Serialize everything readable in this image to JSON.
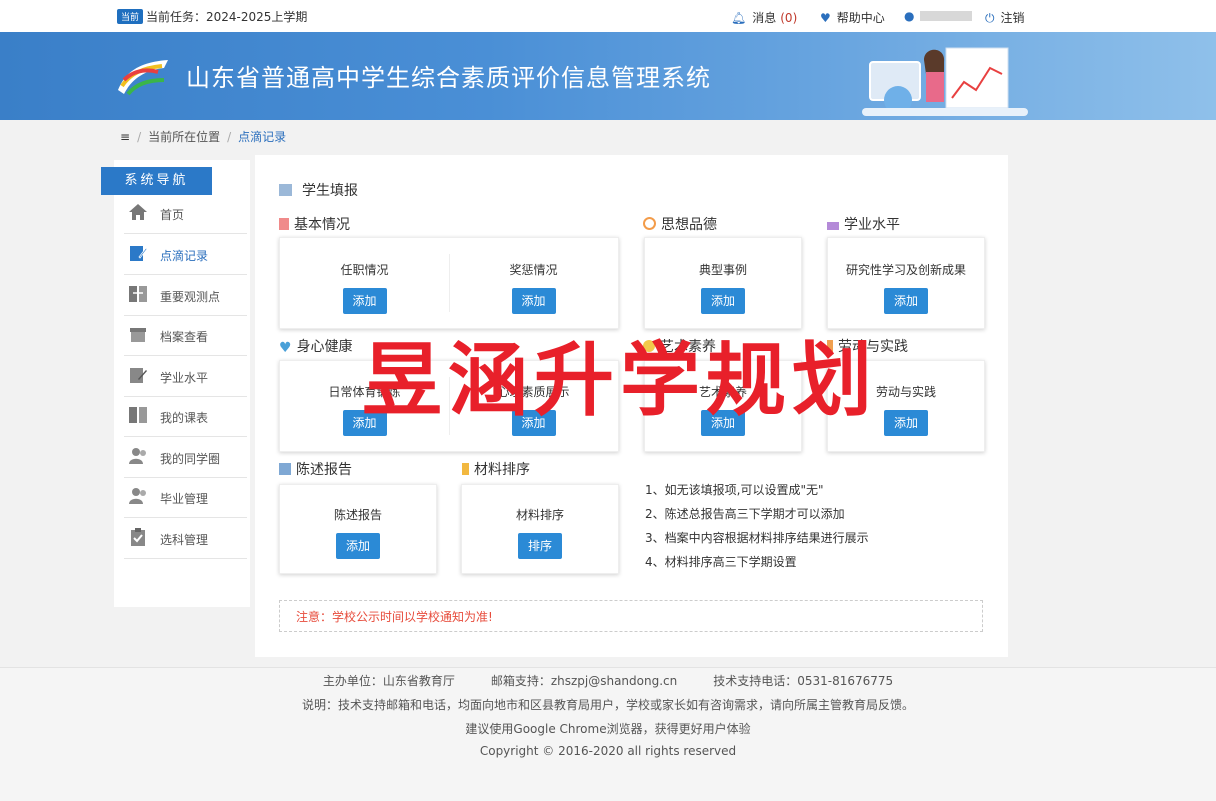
{
  "topbar": {
    "tag": "当前",
    "term_label": "当前任务：2024-2025上学期",
    "messages_label": "消息",
    "messages_count": "(0)",
    "help_label": "帮助中心",
    "logout_label": "注销"
  },
  "banner": {
    "title": "山东省普通高中学生综合素质评价信息管理系统"
  },
  "breadcrumb": {
    "location": "当前所在位置",
    "current": "点滴记录"
  },
  "sidebar": {
    "header": "系统导航",
    "items": [
      {
        "label": "首页"
      },
      {
        "label": "点滴记录"
      },
      {
        "label": "重要观测点"
      },
      {
        "label": "档案查看"
      },
      {
        "label": "学业水平"
      },
      {
        "label": "我的课表"
      },
      {
        "label": "我的同学圈"
      },
      {
        "label": "毕业管理"
      },
      {
        "label": "选科管理"
      }
    ]
  },
  "main": {
    "title": "学生填报",
    "sections": {
      "basic": {
        "title": "基本情况",
        "items": [
          "任职情况",
          "奖惩情况"
        ]
      },
      "moral": {
        "title": "思想品德",
        "items": [
          "典型事例"
        ]
      },
      "academic": {
        "title": "学业水平",
        "items": [
          "研究性学习及创新成果"
        ]
      },
      "health": {
        "title": "身心健康",
        "items": [
          "日常体育锻炼",
          "心理素质展示"
        ]
      },
      "art": {
        "title": "艺术素养",
        "items": [
          "艺术素养"
        ]
      },
      "labor": {
        "title": "劳动与实践",
        "items": [
          "劳动与实践"
        ]
      },
      "report": {
        "title": "陈述报告",
        "items": [
          "陈述报告"
        ]
      },
      "sort": {
        "title": "材料排序",
        "items": [
          "材料排序"
        ]
      }
    },
    "add_label": "添加",
    "sort_label": "排序",
    "notes": [
      "1、如无该填报项,可以设置成\"无\"",
      "2、陈述总报告高三下学期才可以添加",
      "3、档案中内容根据材料排序结果进行展示",
      "4、材料排序高三下学期设置"
    ],
    "notice": "注意：学校公示时间以学校通知为准!"
  },
  "footer": {
    "line1": "主办单位：山东省教育厅　　　邮箱支持：zhszpj@shandong.cn　　　技术支持电话：0531-81676775",
    "line2": "说明：技术支持邮箱和电话，均面向地市和区县教育局用户，学校或家长如有咨询需求，请向所属主管教育局反馈。",
    "line3": "建议使用Google Chrome浏览器，获得更好用户体验",
    "line4": "Copyright © 2016-2020 all rights reserved"
  },
  "watermark": "昱涵升学规划",
  "colors": {
    "primary": "#2b79c8",
    "button": "#2b8ad6",
    "notice": "#e74c3c",
    "watermark": "#e8202a"
  }
}
